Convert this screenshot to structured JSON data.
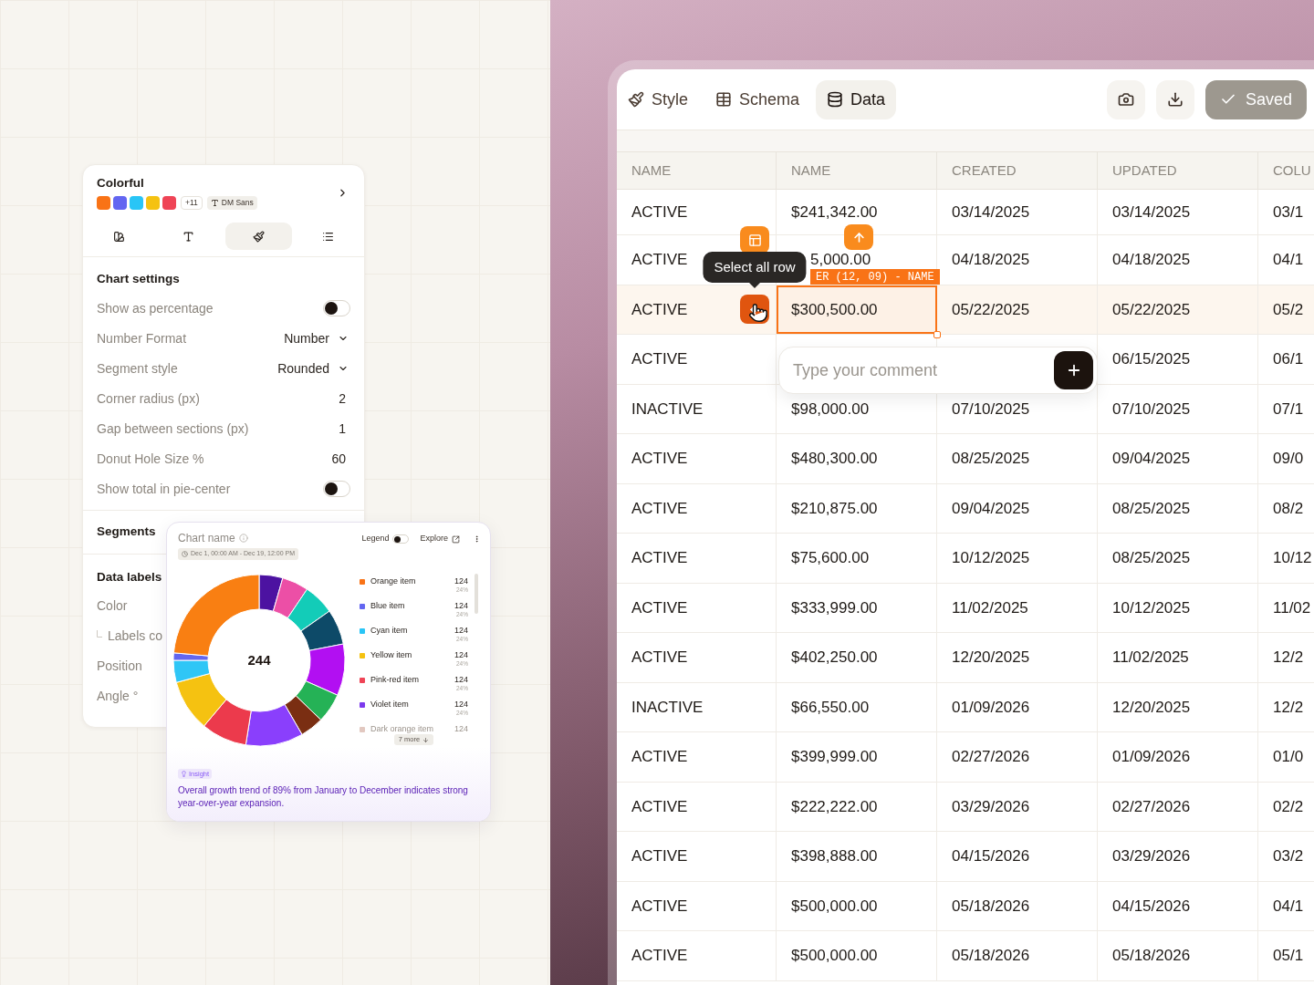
{
  "settings_panel": {
    "theme": {
      "name": "Colorful",
      "swatches": [
        {
          "color": "#f97316"
        },
        {
          "color": "#6366f1"
        },
        {
          "color": "#29c5f6"
        },
        {
          "color": "#f5c211"
        },
        {
          "color": "#ef4456"
        }
      ],
      "more": "+11",
      "font": "DM Sans"
    },
    "tabs": [
      {
        "selected": false
      },
      {
        "selected": false
      },
      {
        "selected": true
      },
      {
        "selected": false
      }
    ],
    "chart_settings": {
      "title": "Chart settings",
      "rows": [
        {
          "kind": "toggle",
          "label": "Show as percentage",
          "on": false
        },
        {
          "kind": "select",
          "label": "Number Format",
          "value": "Number"
        },
        {
          "kind": "select",
          "label": "Segment style",
          "value": "Rounded"
        },
        {
          "kind": "value",
          "label": "Corner radius (px)",
          "value": "2"
        },
        {
          "kind": "value",
          "label": "Gap between sections (px)",
          "value": "1"
        },
        {
          "kind": "value",
          "label": "Donut Hole Size %",
          "value": "60"
        },
        {
          "kind": "toggle",
          "label": "Show total in pie-center",
          "on": false
        }
      ]
    },
    "segments": {
      "title": "Segments"
    },
    "data_labels": {
      "title": "Data labels",
      "rows": [
        {
          "label": "Color",
          "children": [
            {
              "label": "Labels co"
            }
          ]
        },
        {
          "label": "Position"
        },
        {
          "label": "Angle °"
        }
      ]
    }
  },
  "chart_card": {
    "title": "Chart name",
    "date_range": "Dec 1, 00:00 AM - Dec 19, 12:00 PM",
    "legend_toggle": {
      "label": "Legend",
      "on": false
    },
    "explore": "Explore",
    "total": "244",
    "legend": [
      {
        "name": "Orange item",
        "value": "124",
        "share": "24%",
        "color": "#f97316",
        "faded": false
      },
      {
        "name": "Blue item",
        "value": "124",
        "share": "24%",
        "color": "#6366f1",
        "faded": false
      },
      {
        "name": "Cyan item",
        "value": "124",
        "share": "24%",
        "color": "#29c5f6",
        "faded": false
      },
      {
        "name": "Yellow item",
        "value": "124",
        "share": "24%",
        "color": "#f5c211",
        "faded": false
      },
      {
        "name": "Pink-red item",
        "value": "124",
        "share": "24%",
        "color": "#ef4456",
        "faded": false
      },
      {
        "name": "Violet item",
        "value": "124",
        "share": "24%",
        "color": "#7c3aed",
        "faded": false
      },
      {
        "name": "Dark orange item",
        "value": "124",
        "color": "#e2c8c0",
        "faded": true
      }
    ],
    "more": "7 more",
    "insight": {
      "label": "Insight",
      "text": "Overall growth trend of 89% from January to December indicates strong year-over-year expansion."
    }
  },
  "toolbar": {
    "tabs": [
      {
        "label": "Style",
        "selected": false
      },
      {
        "label": "Schema",
        "selected": false
      },
      {
        "label": "Data",
        "selected": true
      }
    ],
    "saved": "Saved"
  },
  "table": {
    "columns": [
      "NAME",
      "NAME",
      "CREATED",
      "UPDATED",
      "COLU"
    ],
    "rows": [
      {
        "selected": false,
        "column_1": "ACTIVE",
        "column_2": "$241,342.00",
        "column_3": "03/14/2025",
        "column_4": "03/14/2025",
        "column_5": "03/1"
      },
      {
        "selected": false,
        "column_1": "ACTIVE",
        "column_2": "5,000.00",
        "column_3": "04/18/2025",
        "column_4": "04/18/2025",
        "column_5": "04/1"
      },
      {
        "selected": true,
        "column_1": "ACTIVE",
        "column_2": "$300,500.00",
        "column_3": "05/22/2025",
        "column_4": "05/22/2025",
        "column_5": "05/2"
      },
      {
        "selected": false,
        "column_1": "ACTIVE",
        "column_4": "06/15/2025",
        "column_5": "06/1"
      },
      {
        "selected": false,
        "column_1": "INACTIVE",
        "column_2": "$98,000.00",
        "column_3": "07/10/2025",
        "column_4": "07/10/2025",
        "column_5": "07/1"
      },
      {
        "selected": false,
        "column_1": "ACTIVE",
        "column_2": "$480,300.00",
        "column_3": "08/25/2025",
        "column_4": "09/04/2025",
        "column_5": "09/0"
      },
      {
        "selected": false,
        "column_1": "ACTIVE",
        "column_2": "$210,875.00",
        "column_3": "09/04/2025",
        "column_4": "08/25/2025",
        "column_5": "08/2"
      },
      {
        "selected": false,
        "column_1": "ACTIVE",
        "column_2": "$75,600.00",
        "column_3": "10/12/2025",
        "column_4": "08/25/2025",
        "column_5": "10/12"
      },
      {
        "selected": false,
        "column_1": "ACTIVE",
        "column_2": "$333,999.00",
        "column_3": "11/02/2025",
        "column_4": "10/12/2025",
        "column_5": "11/02"
      },
      {
        "selected": false,
        "column_1": "ACTIVE",
        "column_2": "$402,250.00",
        "column_3": "12/20/2025",
        "column_4": "11/02/2025",
        "column_5": "12/2"
      },
      {
        "selected": false,
        "column_1": "INACTIVE",
        "column_2": "$66,550.00",
        "column_3": "01/09/2026",
        "column_4": "12/20/2025",
        "column_5": "12/2"
      },
      {
        "selected": false,
        "column_1": "ACTIVE",
        "column_2": "$399,999.00",
        "column_3": "02/27/2026",
        "column_4": "01/09/2026",
        "column_5": "01/0"
      },
      {
        "selected": false,
        "column_1": "ACTIVE",
        "column_2": "$222,222.00",
        "column_3": "03/29/2026",
        "column_4": "02/27/2026",
        "column_5": "02/2"
      },
      {
        "selected": false,
        "column_1": "ACTIVE",
        "column_2": "$398,888.00",
        "column_3": "04/15/2026",
        "column_4": "03/29/2026",
        "column_5": "03/2"
      },
      {
        "selected": false,
        "column_1": "ACTIVE",
        "column_2": "$500,000.00",
        "column_3": "05/18/2026",
        "column_4": "04/15/2026",
        "column_5": "04/1"
      },
      {
        "selected": false,
        "column_1": "ACTIVE",
        "column_2": "$500,000.00",
        "column_3": "05/18/2026",
        "column_4": "05/18/2026",
        "column_5": "05/1"
      }
    ]
  },
  "overlay": {
    "tooltip": "Select all row",
    "cell_reference": "ER (12, 09) - NAME",
    "comment": {
      "placeholder": "Type your comment"
    }
  }
}
